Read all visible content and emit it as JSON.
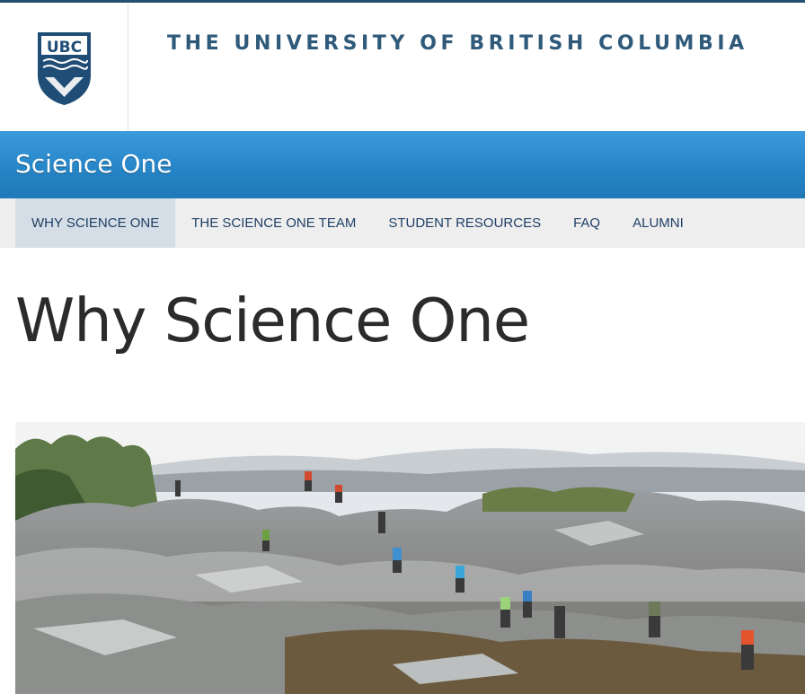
{
  "brand": {
    "logo_text": "UBC",
    "wordmark": "THE UNIVERSITY OF BRITISH COLUMBIA",
    "colors": {
      "wordmark": "#2f5a7a",
      "crest": "#1f4d75",
      "top_rule": "#24506e"
    }
  },
  "site": {
    "title": "Science One",
    "colors": {
      "bar_top": "#3c9bdc",
      "bar_bottom": "#1f79b8"
    }
  },
  "nav": {
    "items": [
      {
        "label": "WHY SCIENCE ONE",
        "active": true
      },
      {
        "label": "THE SCIENCE ONE TEAM",
        "active": false
      },
      {
        "label": "STUDENT RESOURCES",
        "active": false
      },
      {
        "label": "FAQ",
        "active": false
      },
      {
        "label": "ALUMNI",
        "active": false
      }
    ],
    "colors": {
      "background": "#eeeeee",
      "active": "#d5dee6",
      "text": "#1f3f66"
    }
  },
  "page": {
    "title": "Why Science One",
    "hero": {
      "icon": "field-trip-photo"
    }
  }
}
